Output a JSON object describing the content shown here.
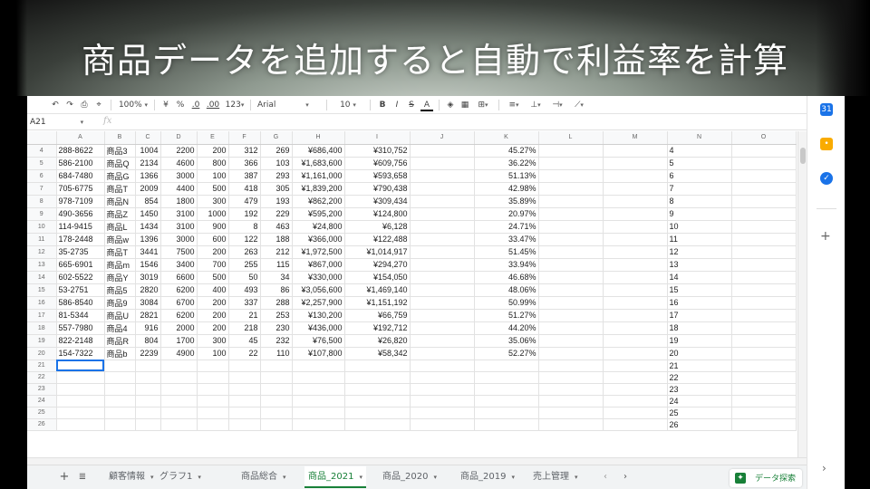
{
  "caption": "商品データを追加すると自動で利益率を計算",
  "toolbar": {
    "zoom": "100%",
    "currency": "¥",
    "percent": "%",
    "dec_less": ".0",
    "dec_more": ".00",
    "format_more": "123",
    "font": "Arial",
    "font_size": "10",
    "bold": "B",
    "italic": "I",
    "strike": "S",
    "text_color": "A"
  },
  "formula_bar": {
    "cell_ref": "A21",
    "fx": "fx"
  },
  "columns": [
    "A",
    "B",
    "C",
    "D",
    "E",
    "F",
    "G",
    "H",
    "I",
    "J",
    "K",
    "L",
    "M",
    "N",
    "O"
  ],
  "rows": [
    {
      "n": "4",
      "a": "288-8622",
      "b": "商品3",
      "c": "1004",
      "d": "2200",
      "e": "200",
      "f": "312",
      "g": "269",
      "h": "¥686,400",
      "i": "¥310,752",
      "k": "45.27%"
    },
    {
      "n": "5",
      "a": "586-2100",
      "b": "商品Q",
      "c": "2134",
      "d": "4600",
      "e": "800",
      "f": "366",
      "g": "103",
      "h": "¥1,683,600",
      "i": "¥609,756",
      "k": "36.22%"
    },
    {
      "n": "6",
      "a": "684-7480",
      "b": "商品G",
      "c": "1366",
      "d": "3000",
      "e": "100",
      "f": "387",
      "g": "293",
      "h": "¥1,161,000",
      "i": "¥593,658",
      "k": "51.13%"
    },
    {
      "n": "7",
      "a": "705-6775",
      "b": "商品T",
      "c": "2009",
      "d": "4400",
      "e": "500",
      "f": "418",
      "g": "305",
      "h": "¥1,839,200",
      "i": "¥790,438",
      "k": "42.98%"
    },
    {
      "n": "8",
      "a": "978-7109",
      "b": "商品N",
      "c": "854",
      "d": "1800",
      "e": "300",
      "f": "479",
      "g": "193",
      "h": "¥862,200",
      "i": "¥309,434",
      "k": "35.89%"
    },
    {
      "n": "9",
      "a": "490-3656",
      "b": "商品Z",
      "c": "1450",
      "d": "3100",
      "e": "1000",
      "f": "192",
      "g": "229",
      "h": "¥595,200",
      "i": "¥124,800",
      "k": "20.97%"
    },
    {
      "n": "10",
      "a": "114-9415",
      "b": "商品L",
      "c": "1434",
      "d": "3100",
      "e": "900",
      "f": "8",
      "g": "463",
      "h": "¥24,800",
      "i": "¥6,128",
      "k": "24.71%"
    },
    {
      "n": "11",
      "a": "178-2448",
      "b": "商品w",
      "c": "1396",
      "d": "3000",
      "e": "600",
      "f": "122",
      "g": "188",
      "h": "¥366,000",
      "i": "¥122,488",
      "k": "33.47%"
    },
    {
      "n": "12",
      "a": "35-2735",
      "b": "商品T",
      "c": "3441",
      "d": "7500",
      "e": "200",
      "f": "263",
      "g": "212",
      "h": "¥1,972,500",
      "i": "¥1,014,917",
      "k": "51.45%"
    },
    {
      "n": "13",
      "a": "665-6901",
      "b": "商品m",
      "c": "1546",
      "d": "3400",
      "e": "700",
      "f": "255",
      "g": "115",
      "h": "¥867,000",
      "i": "¥294,270",
      "k": "33.94%"
    },
    {
      "n": "14",
      "a": "602-5522",
      "b": "商品Y",
      "c": "3019",
      "d": "6600",
      "e": "500",
      "f": "50",
      "g": "34",
      "h": "¥330,000",
      "i": "¥154,050",
      "k": "46.68%"
    },
    {
      "n": "15",
      "a": "53-2751",
      "b": "商品5",
      "c": "2820",
      "d": "6200",
      "e": "400",
      "f": "493",
      "g": "86",
      "h": "¥3,056,600",
      "i": "¥1,469,140",
      "k": "48.06%"
    },
    {
      "n": "16",
      "a": "586-8540",
      "b": "商品9",
      "c": "3084",
      "d": "6700",
      "e": "200",
      "f": "337",
      "g": "288",
      "h": "¥2,257,900",
      "i": "¥1,151,192",
      "k": "50.99%"
    },
    {
      "n": "17",
      "a": "81-5344",
      "b": "商品U",
      "c": "2821",
      "d": "6200",
      "e": "200",
      "f": "21",
      "g": "253",
      "h": "¥130,200",
      "i": "¥66,759",
      "k": "51.27%"
    },
    {
      "n": "18",
      "a": "557-7980",
      "b": "商品4",
      "c": "916",
      "d": "2000",
      "e": "200",
      "f": "218",
      "g": "230",
      "h": "¥436,000",
      "i": "¥192,712",
      "k": "44.20%"
    },
    {
      "n": "19",
      "a": "822-2148",
      "b": "商品R",
      "c": "804",
      "d": "1700",
      "e": "300",
      "f": "45",
      "g": "232",
      "h": "¥76,500",
      "i": "¥26,820",
      "k": "35.06%"
    },
    {
      "n": "20",
      "a": "154-7322",
      "b": "商品b",
      "c": "2239",
      "d": "4900",
      "e": "100",
      "f": "22",
      "g": "110",
      "h": "¥107,800",
      "i": "¥58,342",
      "k": "52.27%"
    },
    {
      "n": "21"
    },
    {
      "n": "22"
    },
    {
      "n": "23"
    },
    {
      "n": "24"
    },
    {
      "n": "25"
    },
    {
      "n": "26"
    }
  ],
  "tabs": [
    {
      "label": "顧客情報"
    },
    {
      "label": "グラフ1"
    },
    {
      "label": "商品総合"
    },
    {
      "label": "商品_2021",
      "active": true
    },
    {
      "label": "商品_2020"
    },
    {
      "label": "商品_2019"
    },
    {
      "label": "売上管理"
    }
  ],
  "explore_label": "データ探索",
  "side_icons": [
    {
      "name": "calendar",
      "color": "#1a73e8",
      "glyph": "31"
    },
    {
      "name": "keep",
      "color": "#f9ab00",
      "glyph": "•"
    },
    {
      "name": "tasks",
      "color": "#1a73e8",
      "glyph": "✓"
    }
  ]
}
